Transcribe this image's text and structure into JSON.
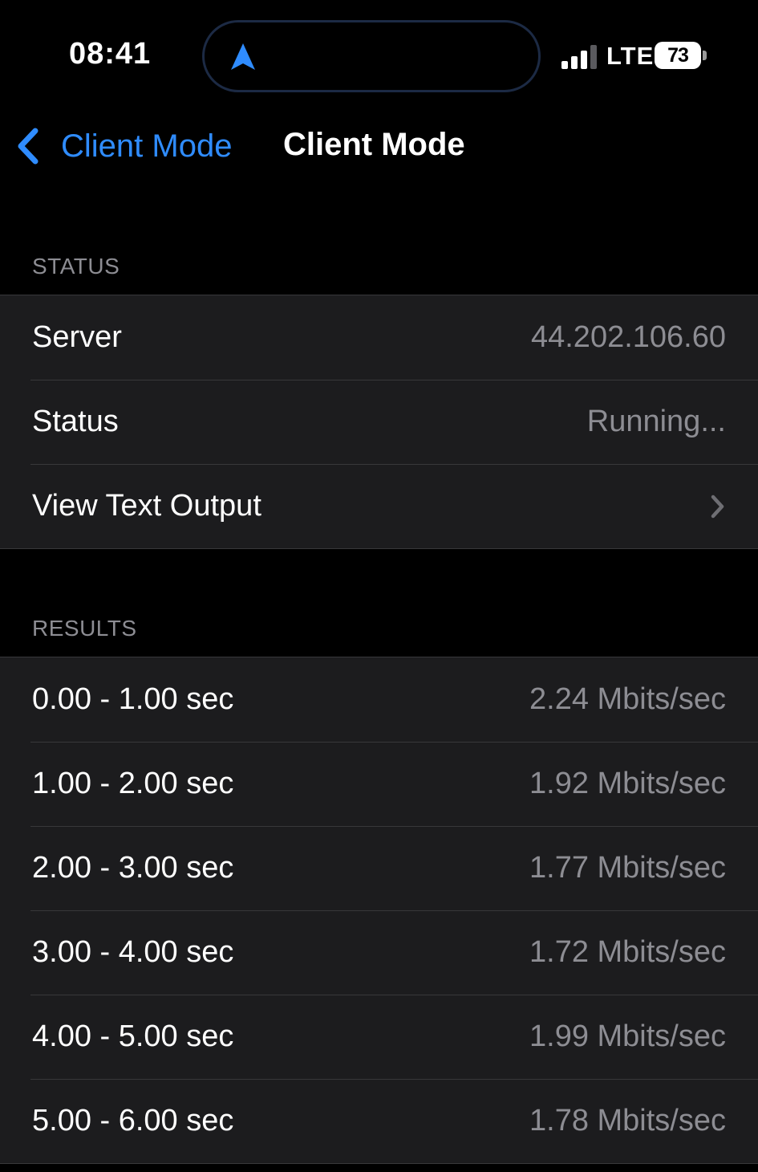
{
  "status_bar": {
    "time": "08:41",
    "network": "LTE",
    "battery": "73",
    "battery_level": 0.73,
    "signal_bars": 3,
    "signal_max": 4
  },
  "nav": {
    "back_label": "Client Mode",
    "title": "Client Mode"
  },
  "status_section": {
    "header": "STATUS",
    "rows": [
      {
        "label": "Server",
        "value": "44.202.106.60"
      },
      {
        "label": "Status",
        "value": "Running..."
      },
      {
        "label": "View Text Output"
      }
    ]
  },
  "results_section": {
    "header": "RESULTS",
    "rows": [
      {
        "label": "0.00 - 1.00 sec",
        "value": "2.24 Mbits/sec"
      },
      {
        "label": "1.00 - 2.00 sec",
        "value": "1.92 Mbits/sec"
      },
      {
        "label": "2.00 - 3.00 sec",
        "value": "1.77 Mbits/sec"
      },
      {
        "label": "3.00 - 4.00 sec",
        "value": "1.72 Mbits/sec"
      },
      {
        "label": "4.00 - 5.00 sec",
        "value": "1.99 Mbits/sec"
      },
      {
        "label": "5.00 - 6.00 sec",
        "value": "1.78 Mbits/sec"
      }
    ]
  },
  "colors": {
    "accent": "#2f8cff",
    "background": "#000000",
    "cell": "#1c1c1e",
    "secondary_text": "#8d8d93",
    "separator": "#38383a"
  },
  "icons": {
    "location": "location-arrow-icon",
    "signal": "cellular-signal-icon",
    "battery": "battery-icon",
    "back": "chevron-left-icon",
    "disclosure": "chevron-right-icon"
  }
}
